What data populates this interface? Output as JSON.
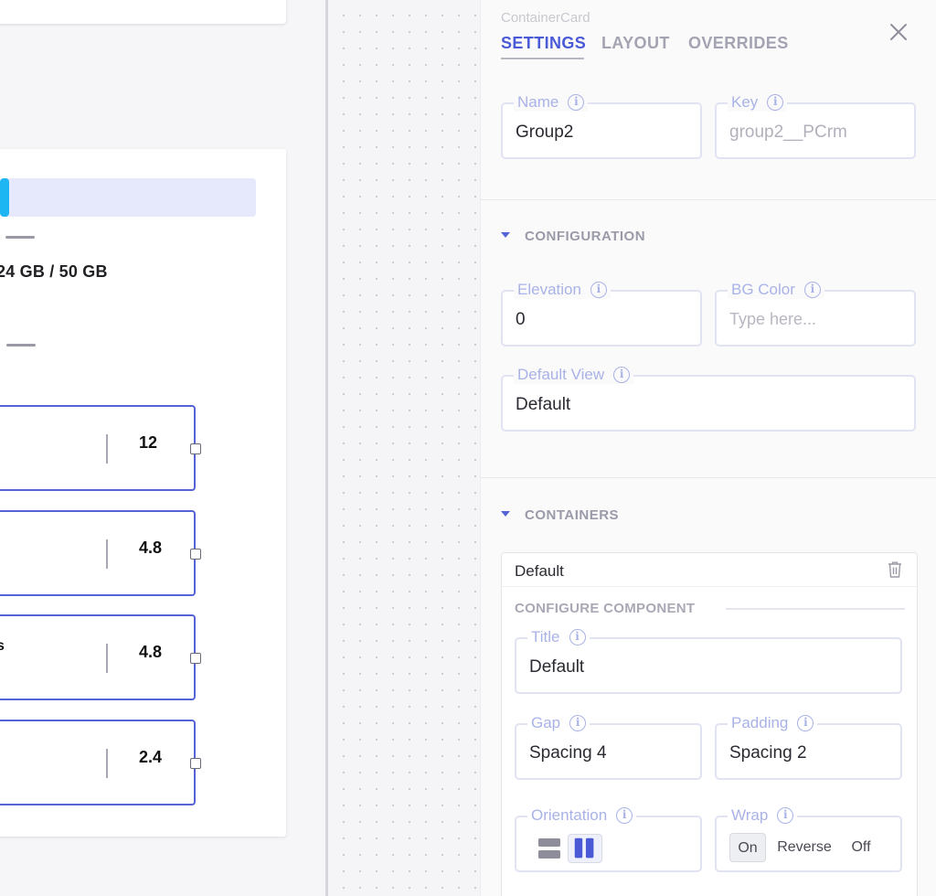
{
  "canvas": {
    "storage_text": "24 GB / 50 GB",
    "progress_fraction": 0.035,
    "rows": [
      {
        "value": "12",
        "text": ""
      },
      {
        "value": "4.8",
        "text": ""
      },
      {
        "value": "4.8",
        "text": "s"
      },
      {
        "value": "2.4",
        "text": ""
      }
    ]
  },
  "panel": {
    "component_name": "ContainerCard",
    "tabs": [
      {
        "label": "SETTINGS",
        "active": true
      },
      {
        "label": "LAYOUT",
        "active": false
      },
      {
        "label": "OVERRIDES",
        "active": false
      }
    ],
    "name_field": {
      "label": "Name",
      "value": "Group2"
    },
    "key_field": {
      "label": "Key",
      "value": "group2__PCrm"
    },
    "configuration": {
      "heading": "CONFIGURATION",
      "elevation": {
        "label": "Elevation",
        "value": "0"
      },
      "bg_color": {
        "label": "BG Color",
        "placeholder": "Type here..."
      },
      "default_view": {
        "label": "Default View",
        "value": "Default"
      }
    },
    "containers": {
      "heading": "CONTAINERS",
      "item_title": "Default",
      "configure_label": "CONFIGURE COMPONENT",
      "title_field": {
        "label": "Title",
        "value": "Default"
      },
      "gap_field": {
        "label": "Gap",
        "value": "Spacing 4"
      },
      "padding_field": {
        "label": "Padding",
        "value": "Spacing 2"
      },
      "orientation": {
        "label": "Orientation",
        "selected": "horizontal"
      },
      "wrap": {
        "label": "Wrap",
        "options": [
          "On",
          "Reverse",
          "Off"
        ],
        "selected": "On"
      }
    }
  },
  "colors": {
    "accent": "#4a5ad6",
    "progress": "#1eb6f2",
    "label": "#a9b2e6"
  },
  "icons": [
    "close-icon",
    "info-icon",
    "caret-down-icon",
    "trash-icon",
    "orientation-vertical-icon",
    "orientation-horizontal-icon",
    "resize-handle-icon"
  ]
}
